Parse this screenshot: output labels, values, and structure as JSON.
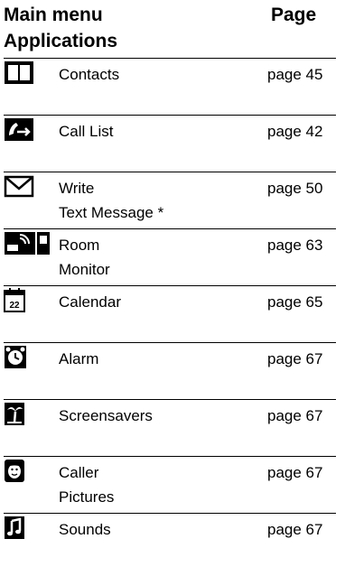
{
  "header": {
    "title_line1": "Main menu",
    "title_line2": "Applications",
    "page_col": "Page"
  },
  "rows": [
    {
      "icon": "contacts-book-icon",
      "label_line1": "Contacts",
      "label_line2": "",
      "page": "page 45"
    },
    {
      "icon": "call-list-icon",
      "label_line1": "Call List",
      "label_line2": "",
      "page": "page 42"
    },
    {
      "icon": "envelope-icon",
      "label_line1": "Write",
      "label_line2": "Text Message *",
      "page": "page 50"
    },
    {
      "icon": "room-monitor-icon",
      "label_line1": "Room",
      "label_line2": "Monitor",
      "page": "page 63"
    },
    {
      "icon": "calendar-icon",
      "label_line1": "Calendar",
      "label_line2": "",
      "page": "page 65",
      "icon_text": "22"
    },
    {
      "icon": "alarm-clock-icon",
      "label_line1": "Alarm",
      "label_line2": "",
      "page": "page 67"
    },
    {
      "icon": "palm-tree-icon",
      "label_line1": "Screensavers",
      "label_line2": "",
      "page": "page 67"
    },
    {
      "icon": "caller-face-icon",
      "label_line1": "Caller",
      "label_line2": "Pictures",
      "page": "page 67"
    },
    {
      "icon": "music-note-icon",
      "label_line1": "Sounds",
      "label_line2": "",
      "page": "page 67"
    }
  ]
}
